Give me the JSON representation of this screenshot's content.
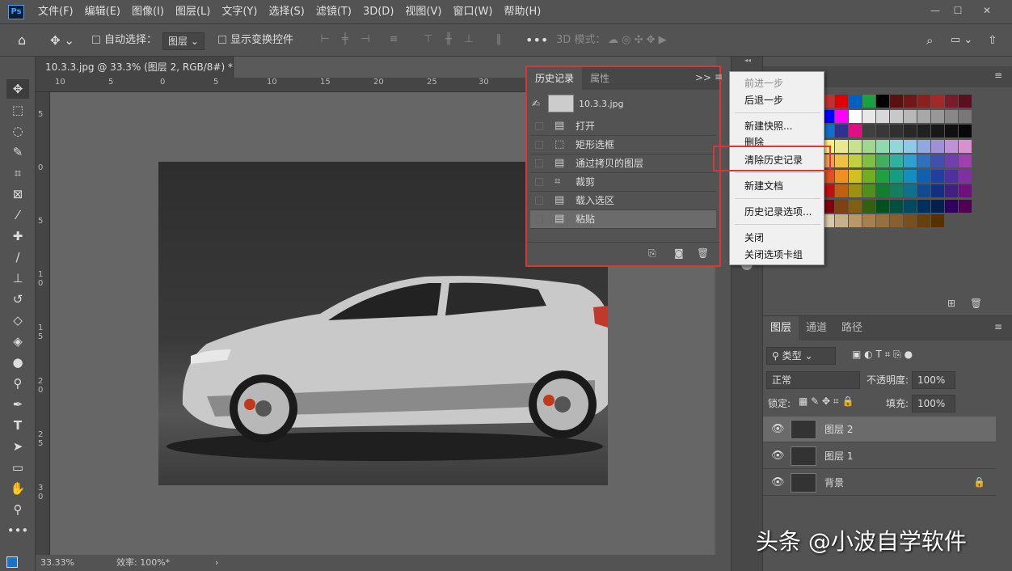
{
  "app": {
    "logo": "Ps"
  },
  "menus": [
    "文件(F)",
    "编辑(E)",
    "图像(I)",
    "图层(L)",
    "文字(Y)",
    "选择(S)",
    "滤镜(T)",
    "3D(D)",
    "视图(V)",
    "窗口(W)",
    "帮助(H)"
  ],
  "options": {
    "auto_select": "自动选择：",
    "layer_select": "图层",
    "show_transform": "显示变换控件",
    "mode_3d": "3D 模式："
  },
  "document": {
    "tab_title": "10.3.3.jpg @ 33.3% (图层 2, RGB/8#) *",
    "close": "×",
    "zoom": "33.33%",
    "efficiency": "效率: 100%*",
    "status_arrow": "›"
  },
  "ruler_h": [
    "10",
    "5",
    "0",
    "5",
    "10",
    "15",
    "20",
    "25",
    "30"
  ],
  "ruler_v": [
    "5",
    "0",
    "5",
    "1 0",
    "1 5",
    "2 0",
    "2 5",
    "3 0"
  ],
  "history": {
    "tabs": [
      "历史记录",
      "属性"
    ],
    "snapshot": "10.3.3.jpg",
    "items": [
      {
        "label": "打开",
        "icon": "document-icon"
      },
      {
        "label": "矩形选框",
        "icon": "marquee-icon"
      },
      {
        "label": "通过拷贝的图层",
        "icon": "document-icon"
      },
      {
        "label": "裁剪",
        "icon": "crop-icon"
      },
      {
        "label": "载入选区",
        "icon": "document-icon"
      },
      {
        "label": "粘贴",
        "icon": "document-icon"
      }
    ],
    "collapse": ">>"
  },
  "context_menu": {
    "group1": [
      "前进一步",
      "后退一步"
    ],
    "group2": [
      "新建快照...",
      "删除",
      "清除历史记录"
    ],
    "group3": [
      "新建文档"
    ],
    "group4": [
      "历史记录选项..."
    ],
    "group5": [
      "关闭",
      "关闭选项卡组"
    ]
  },
  "layers": {
    "tabs": [
      "图层",
      "通道",
      "路径"
    ],
    "filter": "类型",
    "blend_mode": "正常",
    "opacity_label": "不透明度:",
    "opacity": "100%",
    "lock_label": "锁定:",
    "fill_label": "填充:",
    "fill": "100%",
    "items": [
      {
        "name": "图层 2",
        "selected": true,
        "locked": false
      },
      {
        "name": "图层 1",
        "selected": false,
        "locked": false
      },
      {
        "name": "背景",
        "selected": false,
        "locked": true
      }
    ]
  },
  "watermark": "头条 @小波自学软件"
}
